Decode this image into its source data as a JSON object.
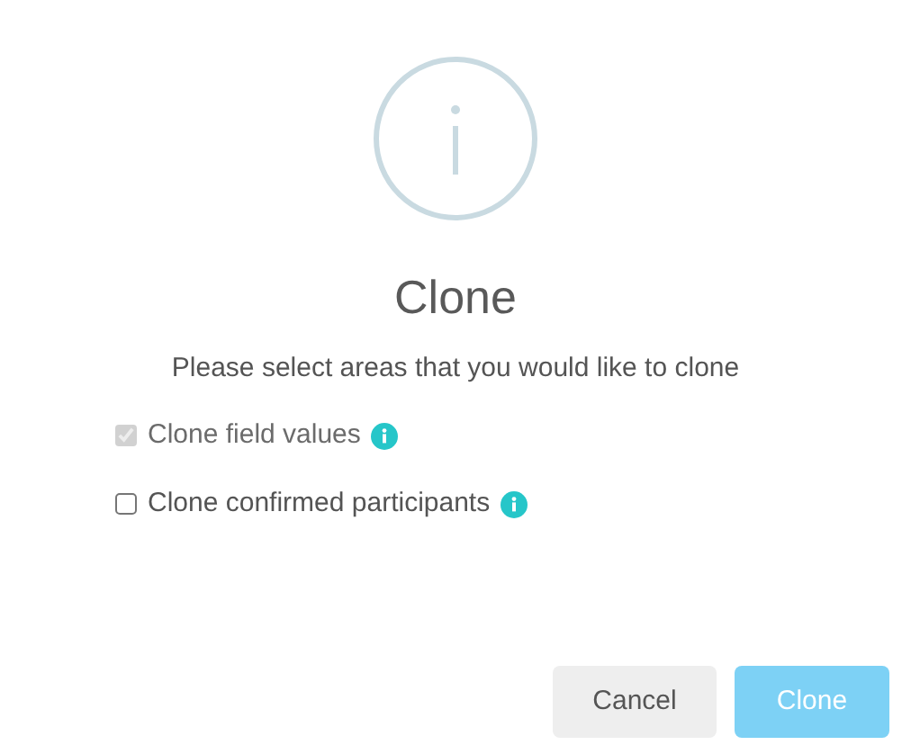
{
  "dialog": {
    "title": "Clone",
    "message": "Please select areas that you would like to clone"
  },
  "options": [
    {
      "label": "Clone field values",
      "checked": true,
      "disabled": true
    },
    {
      "label": "Clone confirmed participants",
      "checked": false,
      "disabled": false
    }
  ],
  "buttons": [
    {
      "label": "Cancel",
      "kind": "secondary"
    },
    {
      "label": "Clone",
      "kind": "primary"
    }
  ]
}
